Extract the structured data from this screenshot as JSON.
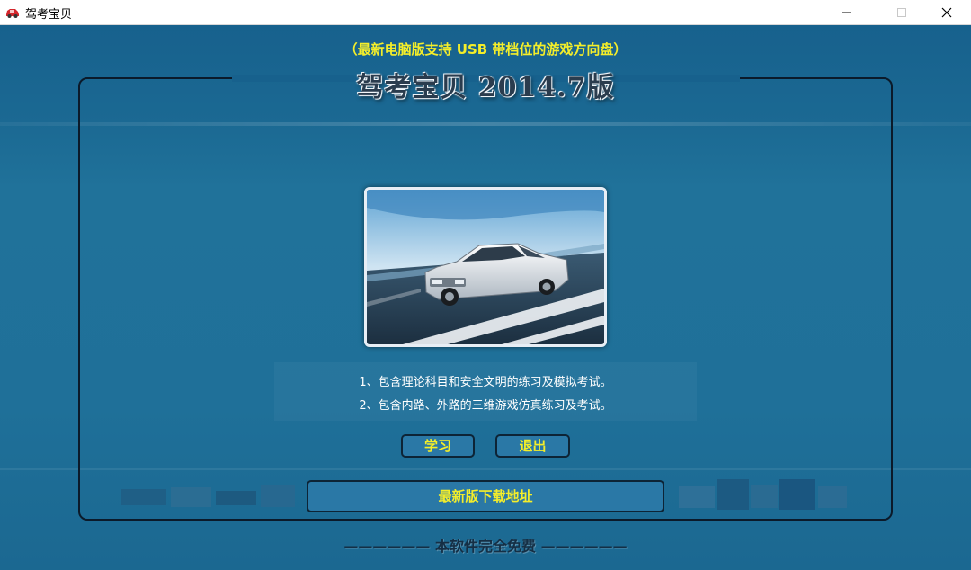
{
  "window": {
    "title": "驾考宝贝",
    "icon": "car-icon",
    "controls": [
      "minimize-icon",
      "maximize-icon",
      "close-icon"
    ]
  },
  "header": {
    "subtitle": "（最新电脑版支持 USB 带档位的游戏方向盘）",
    "title": "驾考宝贝 2014.7版"
  },
  "features": [
    "1、包含理论科目和安全文明的练习及模拟考试。",
    "2、包含内路、外路的三维游戏仿真练习及考试。"
  ],
  "buttons": {
    "study": "学习",
    "exit": "退出",
    "download": "最新版下载地址"
  },
  "footer": {
    "text": "——————  本软件完全免费  ——————"
  },
  "colors": {
    "background": "#1b6690",
    "button_text": "#f4ee2a",
    "button_bg": "#2a78a6"
  }
}
